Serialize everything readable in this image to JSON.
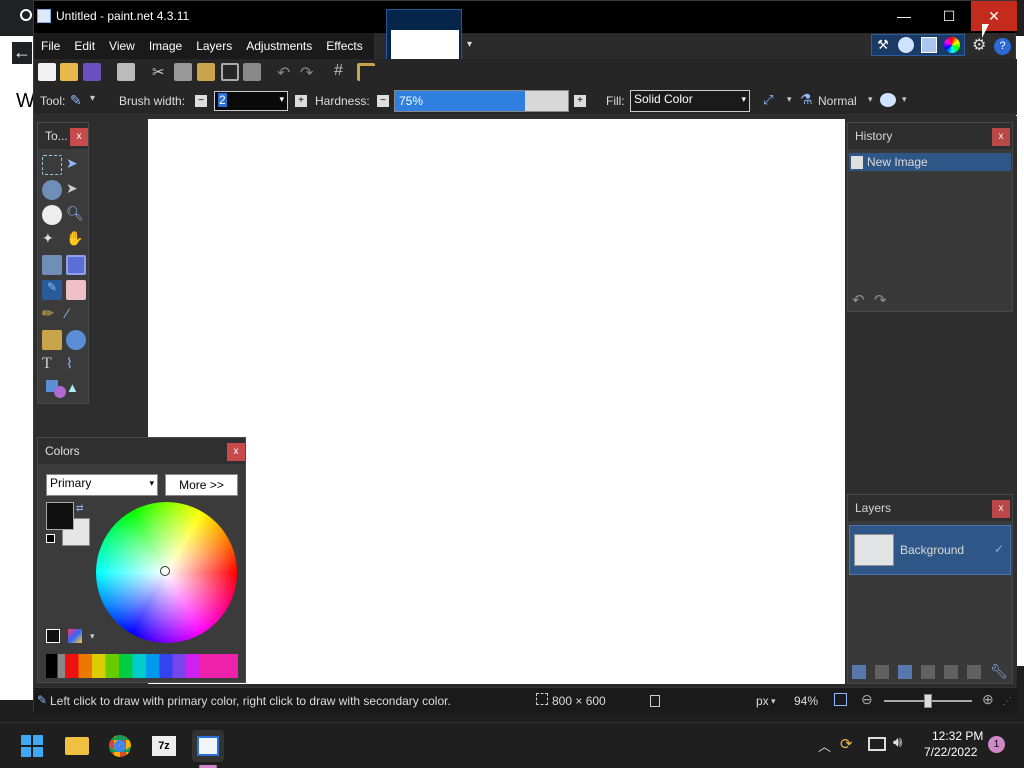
{
  "window": {
    "title": "Untitled - paint.net 4.3.11"
  },
  "background_browser": {
    "partial_text": "W"
  },
  "menu": [
    "File",
    "Edit",
    "View",
    "Image",
    "Layers",
    "Adjustments",
    "Effects"
  ],
  "toolbar": {
    "tool_label": "Tool:",
    "brush_width_label": "Brush width:",
    "brush_width_value": "2",
    "hardness_label": "Hardness:",
    "hardness_value": "75%",
    "hardness_fraction": 0.75,
    "fill_label": "Fill:",
    "fill_value": "Solid Color",
    "blend_mode": "Normal"
  },
  "tools_panel": {
    "title": "To...",
    "close": "x"
  },
  "colors_panel": {
    "title": "Colors",
    "close": "x",
    "mode_select": "Primary",
    "more_button": "More >>",
    "primary_color": "#111111",
    "secondary_color": "#e6e6e6"
  },
  "history_panel": {
    "title": "History",
    "close": "x",
    "items": [
      "New Image"
    ]
  },
  "layers_panel": {
    "title": "Layers",
    "close": "x",
    "items": [
      "Background"
    ]
  },
  "status": {
    "hint": "Left click to draw with primary color, right click to draw with secondary color.",
    "image_size": "800 × 600",
    "units": "px",
    "zoom": "94%"
  },
  "taskbar": {
    "time": "12:32 PM",
    "date": "7/22/2022",
    "notification_count": "1"
  },
  "colors": {
    "accent": "#0078d7",
    "close_red": "#c42b1c"
  }
}
